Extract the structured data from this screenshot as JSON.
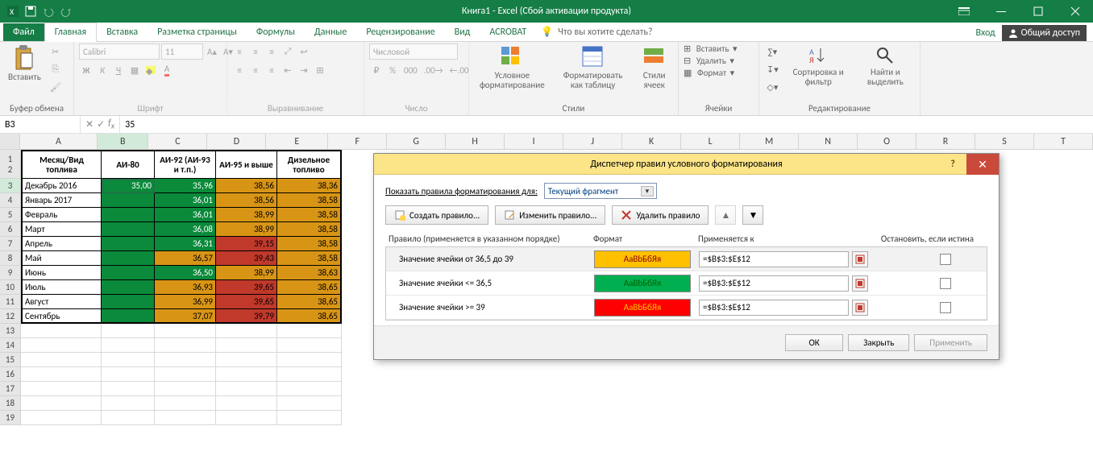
{
  "titlebar": {
    "title": "Книга1 - Excel (Сбой активации продукта)"
  },
  "tabs": {
    "file": "Файл",
    "items": [
      "Главная",
      "Вставка",
      "Разметка страницы",
      "Формулы",
      "Данные",
      "Рецензирование",
      "Вид",
      "ACROBAT"
    ],
    "tell_me": "Что вы хотите сделать?",
    "login": "Вход",
    "share": "Общий доступ"
  },
  "ribbon": {
    "paste": "Вставить",
    "clipboard_label": "Буфер обмена",
    "font_name": "Calibri",
    "font_size": "11",
    "font_label": "Шрифт",
    "align_label": "Выравнивание",
    "number_format": "Числовой",
    "number_label": "Число",
    "cond_fmt": "Условное форматирование",
    "fmt_table": "Форматировать как таблицу",
    "cell_styles": "Стили ячеек",
    "styles_label": "Стили",
    "insert_cells": "Вставить",
    "delete_cells": "Удалить",
    "format_cells": "Формат",
    "cells_label": "Ячейки",
    "sort_filter": "Сортировка и фильтр",
    "find_select": "Найти и выделить",
    "editing_label": "Редактирование"
  },
  "namebox": {
    "cell": "B3",
    "formula": "35"
  },
  "columns": [
    "A",
    "B",
    "C",
    "D",
    "E",
    "F",
    "G",
    "H",
    "I",
    "J",
    "K",
    "L",
    "M",
    "N",
    "O",
    "R",
    "S",
    "T"
  ],
  "th": {
    "a": "Месяц/Вид топлива",
    "b": "АИ-80",
    "c": "АИ-92 (АИ-93 и т.п.)",
    "d": "АИ-95 и выше",
    "e": "Дизельное топливо"
  },
  "rows": [
    {
      "m": "Декабрь 2016",
      "b": "35,00",
      "c": "35,96",
      "d": "38,56",
      "e": "38,36"
    },
    {
      "m": "Январь 2017",
      "b": "",
      "c": "36,01",
      "d": "38,56",
      "e": "38,58"
    },
    {
      "m": "Февраль",
      "b": "",
      "c": "36,01",
      "d": "38,99",
      "e": "38,58"
    },
    {
      "m": "Март",
      "b": "",
      "c": "36,08",
      "d": "38,99",
      "e": "38,58"
    },
    {
      "m": "Апрель",
      "b": "",
      "c": "36,31",
      "d": "39,15",
      "e": "38,58"
    },
    {
      "m": "Май",
      "b": "",
      "c": "36,57",
      "d": "39,43",
      "e": "38,58"
    },
    {
      "m": "Июнь",
      "b": "",
      "c": "36,50",
      "d": "38,99",
      "e": "38,63"
    },
    {
      "m": "Июль",
      "b": "",
      "c": "36,93",
      "d": "39,65",
      "e": "38,65"
    },
    {
      "m": "Август",
      "b": "",
      "c": "36,99",
      "d": "39,65",
      "e": "38,65"
    },
    {
      "m": "Сентябрь",
      "b": "",
      "c": "37,07",
      "d": "39,79",
      "e": "38,65"
    }
  ],
  "dialog": {
    "title": "Диспетчер правил условного форматирования",
    "show_rules_for": "Показать правила форматирования для:",
    "scope": "Текущий фрагмент",
    "new_rule": "Создать правило...",
    "edit_rule": "Изменить правило...",
    "delete_rule": "Удалить правило",
    "hdr_rule": "Правило (применяется в указанном порядке)",
    "hdr_format": "Формат",
    "hdr_applies": "Применяется к",
    "hdr_stop": "Остановить, если истина",
    "sample": "АаВbБбЯя",
    "rules": [
      {
        "desc": "Значение ячейки от 36,5 до 39",
        "applies": "=$B$3:$E$12",
        "cls": "fmt-orange"
      },
      {
        "desc": "Значение ячейки <= 36,5",
        "applies": "=$B$3:$E$12",
        "cls": "fmt-green"
      },
      {
        "desc": "Значение ячейки >= 39",
        "applies": "=$B$3:$E$12",
        "cls": "fmt-red"
      }
    ],
    "ok": "ОК",
    "close": "Закрыть",
    "apply": "Применить"
  }
}
